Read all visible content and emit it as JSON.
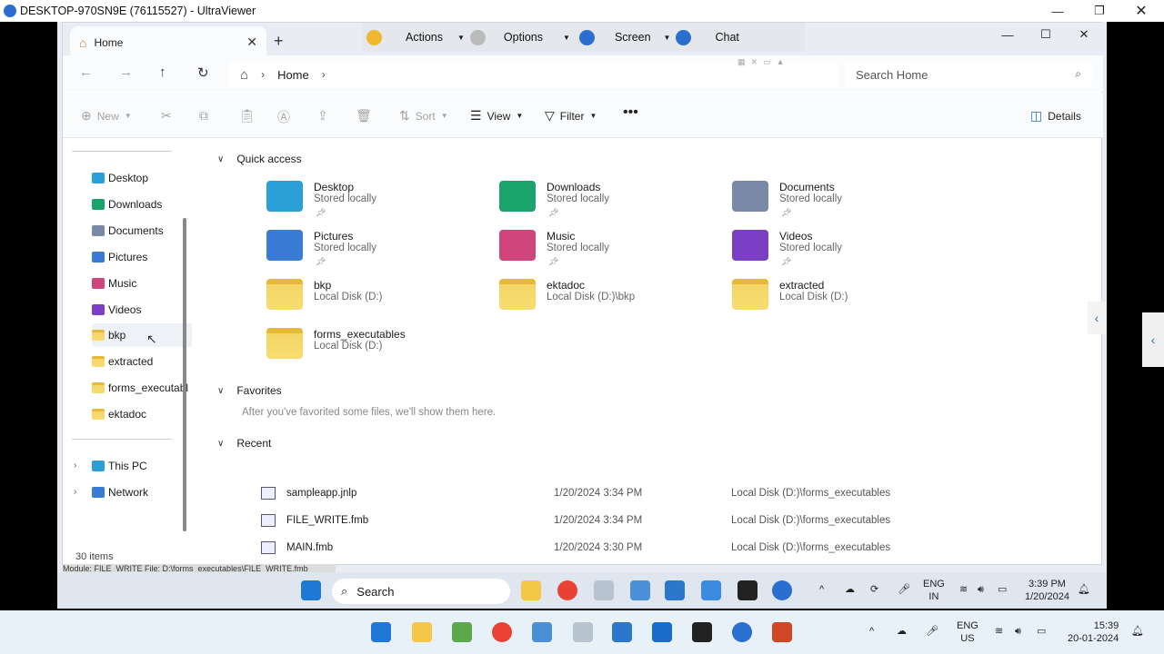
{
  "outer_window": {
    "title": "DESKTOP-970SN9E (76115527) - UltraViewer"
  },
  "tab": {
    "label": "Home"
  },
  "ultraviewer": {
    "actions": "Actions",
    "options": "Options",
    "screen": "Screen",
    "chat": "Chat"
  },
  "address": {
    "home": "Home",
    "search_placeholder": "Search Home"
  },
  "commands": {
    "new": "New",
    "sort": "Sort",
    "view": "View",
    "filter": "Filter",
    "details": "Details"
  },
  "nav": {
    "pinned": [
      {
        "label": "Desktop",
        "color": "#2b9fd8"
      },
      {
        "label": "Downloads",
        "color": "#1aa36b"
      },
      {
        "label": "Documents",
        "color": "#7a8aa6"
      },
      {
        "label": "Pictures",
        "color": "#3a7bd5"
      },
      {
        "label": "Music",
        "color": "#d0457b"
      },
      {
        "label": "Videos",
        "color": "#7b3fc6"
      }
    ],
    "folders": [
      "bkp",
      "extracted",
      "forms_executabl",
      "ektadoc"
    ],
    "this_pc": "This PC",
    "network": "Network"
  },
  "sections": {
    "quick_access": "Quick access",
    "favorites": "Favorites",
    "favorites_empty": "After you've favorited some files, we'll show them here.",
    "recent": "Recent"
  },
  "quick_access": [
    {
      "name": "Desktop",
      "sub": "Stored locally",
      "color": "#2b9fd8"
    },
    {
      "name": "Downloads",
      "sub": "Stored locally",
      "color": "#1aa36b"
    },
    {
      "name": "Documents",
      "sub": "Stored locally",
      "color": "#7a8aa6"
    },
    {
      "name": "Pictures",
      "sub": "Stored locally",
      "color": "#3a7bd5"
    },
    {
      "name": "Music",
      "sub": "Stored locally",
      "color": "#d0457b"
    },
    {
      "name": "Videos",
      "sub": "Stored locally",
      "color": "#7b3fc6"
    },
    {
      "name": "bkp",
      "sub": "Local Disk (D:)"
    },
    {
      "name": "ektadoc",
      "sub": "Local Disk (D:)\\bkp"
    },
    {
      "name": "extracted",
      "sub": "Local Disk (D:)"
    },
    {
      "name": "forms_executables",
      "sub": "Local Disk (D:)"
    }
  ],
  "recent": [
    {
      "name": "sampleapp.jnlp",
      "date": "1/20/2024 3:34 PM",
      "location": "Local Disk (D:)\\forms_executables"
    },
    {
      "name": "FILE_WRITE.fmb",
      "date": "1/20/2024 3:34 PM",
      "location": "Local Disk (D:)\\forms_executables"
    },
    {
      "name": "MAIN.fmb",
      "date": "1/20/2024 3:30 PM",
      "location": "Local Disk (D:)\\forms_executables"
    }
  ],
  "status": {
    "items": "30 items",
    "tooltip": "Module: FILE_WRITE File: D:\\forms_executables\\FILE_WRITE.fmb"
  },
  "inner_taskbar": {
    "search": "Search",
    "lang1": "ENG",
    "lang2": "IN",
    "time": "3:39 PM",
    "date": "1/20/2024"
  },
  "outer_taskbar": {
    "lang1": "ENG",
    "lang2": "US",
    "time": "15:39",
    "date": "20-01-2024"
  }
}
